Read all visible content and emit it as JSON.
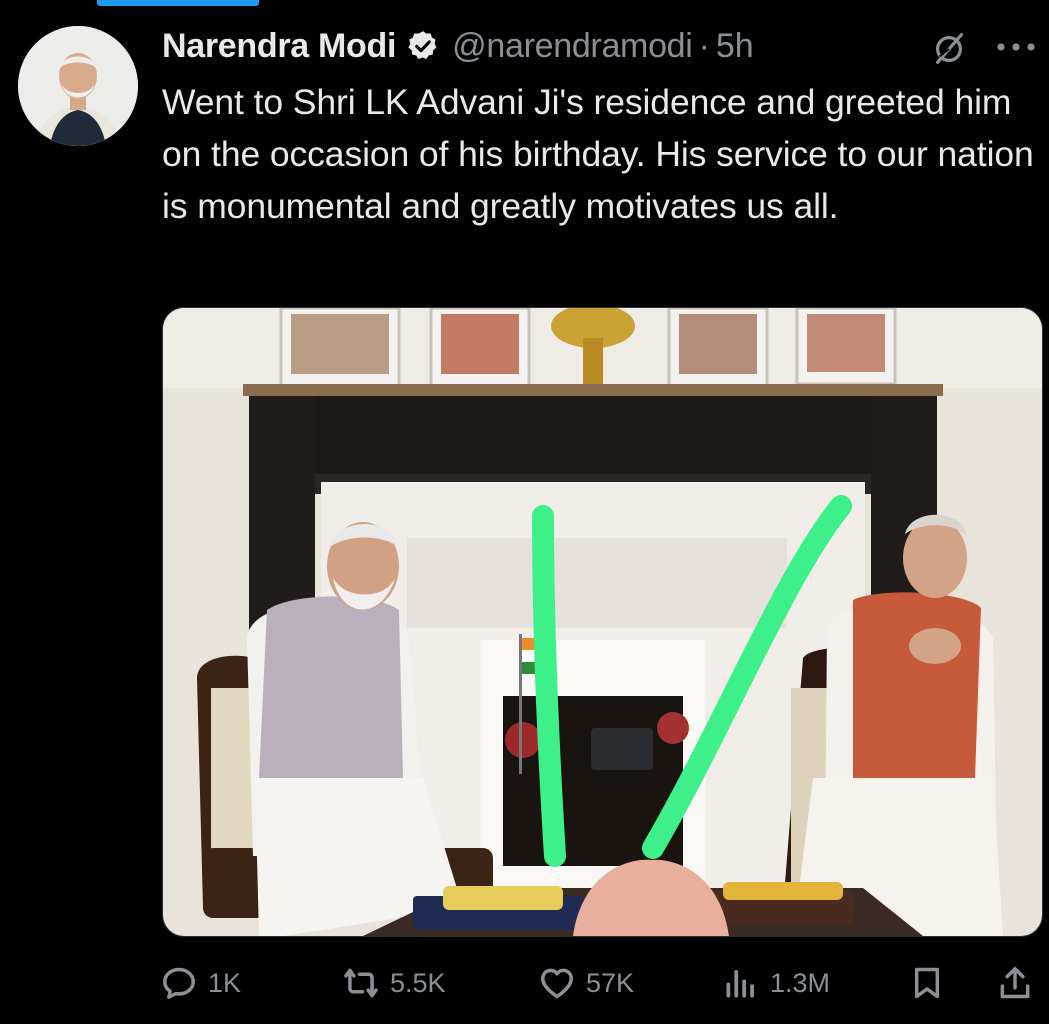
{
  "tweet": {
    "author_name": "Narendra Modi",
    "handle": "@narendramodi",
    "separator": "·",
    "time": "5h",
    "text": "Went to Shri LK Advani Ji's residence and greeted him on the occasion of his birthday. His service to our nation is monumental and greatly motivates us all."
  },
  "icons": {
    "verified": "verified-badge-icon",
    "grok": "grok-icon",
    "more": "more-dots-icon",
    "reply": "reply-icon",
    "repost": "repost-icon",
    "like": "like-icon",
    "views": "views-icon",
    "bookmark": "bookmark-icon",
    "share": "share-icon"
  },
  "actions": {
    "replies": "1K",
    "reposts": "5.5K",
    "likes": "57K",
    "views": "1.3M"
  },
  "colors": {
    "background": "#000000",
    "text": "#e7e9ea",
    "muted": "#8b9096",
    "accent": "#1d9bf0",
    "annotation": "#3ef08a"
  }
}
